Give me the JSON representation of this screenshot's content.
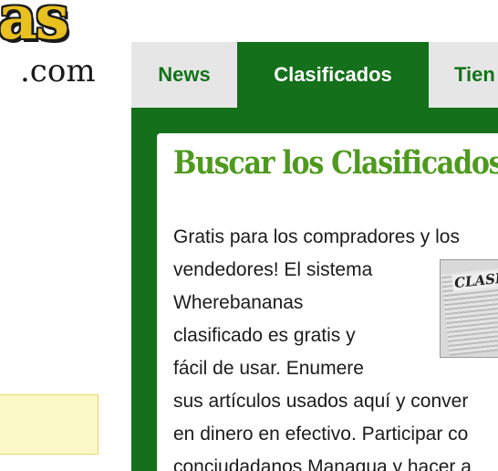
{
  "logo": {
    "main_text": "as",
    "suffix": ".com"
  },
  "tabs": [
    {
      "label": "News"
    },
    {
      "label": "Clasificados"
    },
    {
      "label": "Tien"
    }
  ],
  "content": {
    "heading": "Buscar los Clasificados",
    "lines": [
      "Gratis para los compradores y los",
      "vendedores! El sistema",
      "Wherebananas",
      "clasificado es gratis y",
      "fácil de usar. Enumere",
      "sus artículos usados aquí y conver",
      "en dinero en efectivo. Participar co",
      "conciudadanos Managua y hacer a"
    ],
    "thumbnail_text": "CLASIF"
  },
  "colors": {
    "brand_green": "#14701a",
    "heading_green": "#4f9a1e",
    "logo_yellow": "#e8c020"
  }
}
